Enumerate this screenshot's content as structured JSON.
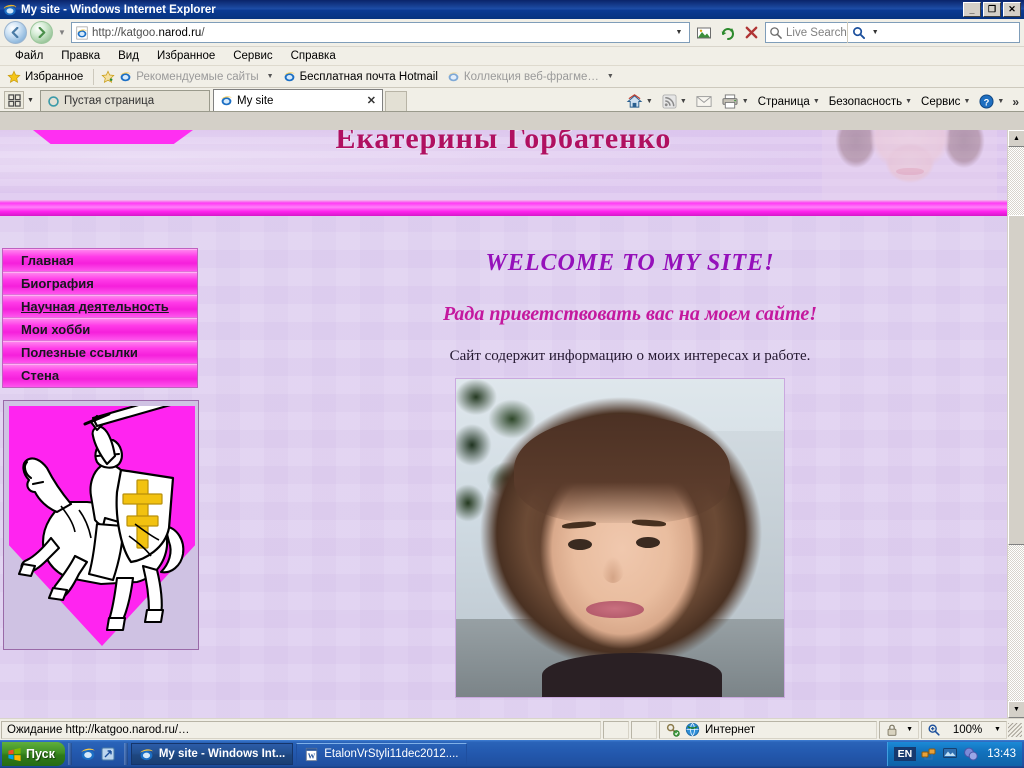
{
  "window": {
    "title": "My site - Windows Internet Explorer",
    "controls": {
      "minimize": "_",
      "restore": "❐",
      "close": "✕"
    }
  },
  "nav": {
    "back_icon": "back-arrow-icon",
    "forward_icon": "forward-arrow-icon",
    "history_caret": "▼",
    "url": "http://katgoo.",
    "url_bold": "narod.ru",
    "url_tail": "/",
    "address_caret": "▼",
    "compat_icon": "compatibility-view-icon",
    "refresh_icon": "↻",
    "stop_icon": "✕",
    "search_placeholder": "Live Search",
    "search_go_icon": "search-icon",
    "search_caret": "▼"
  },
  "menu": {
    "items": [
      {
        "label": "Файл",
        "accel": "Ф"
      },
      {
        "label": "Правка",
        "accel": "П"
      },
      {
        "label": "Вид",
        "accel": "В"
      },
      {
        "label": "Избранное",
        "accel": "И"
      },
      {
        "label": "Сервис",
        "accel": "С"
      },
      {
        "label": "Справка",
        "accel": "п"
      }
    ]
  },
  "favorites_bar": {
    "favorites_label": "Избранное",
    "items": [
      {
        "label": "Рекомендуемые сайты",
        "has_caret": true
      },
      {
        "label": "Бесплатная почта Hotmail",
        "has_caret": false
      },
      {
        "label": "Коллекция веб-фрагме…",
        "has_caret": true
      }
    ]
  },
  "tabs": {
    "quick_tabs_icon": "quick-tabs-icon",
    "tab_list_caret": "▼",
    "items": [
      {
        "label": "Пустая страница",
        "active": false,
        "close": ""
      },
      {
        "label": "My site",
        "active": true,
        "close": "✕"
      }
    ]
  },
  "command_bar": {
    "home_label": "",
    "items": [
      {
        "name": "home",
        "icon": "home-icon",
        "caret": "▼"
      },
      {
        "name": "feeds",
        "icon": "rss-icon",
        "caret": "▼"
      },
      {
        "name": "mail",
        "icon": "mail-icon",
        "caret": ""
      },
      {
        "name": "print",
        "icon": "printer-icon",
        "caret": "▼"
      }
    ],
    "menus": [
      {
        "label": "Страница",
        "caret": "▼"
      },
      {
        "label": "Безопасность",
        "caret": "▼"
      },
      {
        "label": "Сервис",
        "caret": "▼"
      },
      {
        "label": "",
        "icon": "help-icon",
        "caret": "▼"
      }
    ],
    "overflow": "»"
  },
  "page": {
    "header_title": "Екатерины Горбатенко",
    "nav_items": [
      {
        "label": "Главная",
        "hovered": false
      },
      {
        "label": "Биография",
        "hovered": false
      },
      {
        "label": "Научная деятельность",
        "hovered": true
      },
      {
        "label": "Мои хобби",
        "hovered": false
      },
      {
        "label": "Полезные ссылки",
        "hovered": false
      },
      {
        "label": "Стена",
        "hovered": false
      }
    ],
    "coat_of_arms_name": "pahonia-coat-of-arms",
    "welcome": "WELCOME TO MY SITE!",
    "greeting": "Рада приветствовать вас на моем сайте!",
    "subtext": "Сайт содержит информацию о моих интересах и работе.",
    "portrait_name": "owner-portrait-photo",
    "colors": {
      "accent_pink": "#ff24f0",
      "title_crimson": "#b01060",
      "welcome_purple": "#9510ba",
      "greeting_magenta": "#c4189e",
      "page_bg": "#dfd0f0"
    }
  },
  "status_bar": {
    "message": "Ожидание http://katgoo.narod.ru/…",
    "zone": "Интернет",
    "zone_icon": "globe-icon",
    "protected_icon": "protected-mode-icon",
    "protected_caret": "▼",
    "zoom_icon": "zoom-icon",
    "zoom": "100%",
    "zoom_caret": "▼"
  },
  "taskbar": {
    "start_label": "Пуск",
    "quick_launch": [
      {
        "name": "internet-explorer",
        "icon": "ie-icon"
      },
      {
        "name": "show-desktop",
        "icon": "desktop-icon"
      }
    ],
    "items": [
      {
        "label": "My site - Windows Int...",
        "icon": "ie-icon",
        "active": true
      },
      {
        "label": "EtalonVrStyli11dec2012....",
        "icon": "word-icon",
        "active": false
      }
    ],
    "tray": {
      "language": "EN",
      "icons": [
        "network-icon",
        "display-icon",
        "messenger-icon"
      ],
      "clock": "13:43"
    }
  }
}
